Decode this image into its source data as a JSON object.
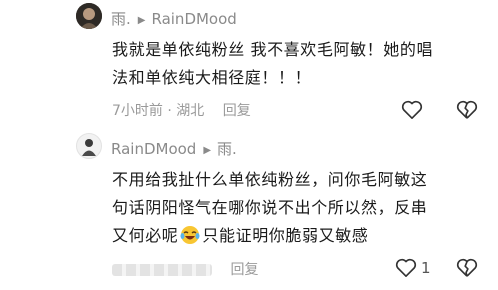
{
  "comment": {
    "author": "雨.",
    "reply_to": "RainDMood",
    "text_lines": [
      "我就是单依纯粉丝 我不喜欢毛阿敏！她的唱",
      "法和单依纯大相径庭！！！"
    ],
    "time_location": "7小时前 · 湖北",
    "reply_label": "回复"
  },
  "reply": {
    "author": "RainDMood",
    "reply_to": "雨.",
    "text_lines": [
      "不用给我扯什么单依纯粉丝，问你毛阿敏这",
      "句话阴阳怪气在哪你说不出个所以然，反串",
      "又何必呢",
      "只能证明你脆弱又敏感"
    ],
    "emoji": "laughing-crying-emoji",
    "reply_label": "回复",
    "like_count": "1"
  },
  "icons": [
    "heart-icon",
    "broken-heart-icon"
  ]
}
